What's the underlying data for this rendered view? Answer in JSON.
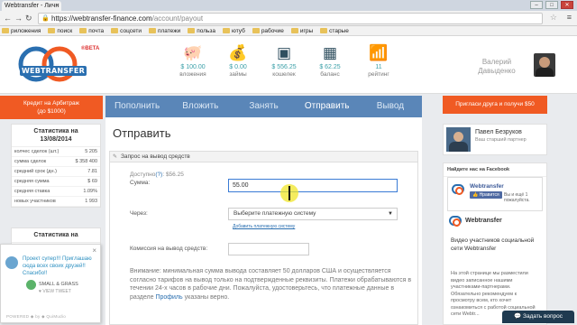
{
  "browser": {
    "tab_title": "Webtransfer - Личн",
    "tab_close": "×",
    "win_min": "–",
    "win_max": "□",
    "win_close": "✕",
    "url_host": "https://webtransfer-finance.com",
    "url_path": "/account/payout",
    "bookmarks": [
      "риложения",
      "поиск",
      "почта",
      "соцсети",
      "платежи",
      "польза",
      "ютуб",
      "рабочие",
      "игры",
      "старые"
    ]
  },
  "header": {
    "logo_text": "WEBTRANSFER",
    "beta": "®BETA",
    "stats": [
      {
        "value": "$ 100.00",
        "caption": "вложения",
        "icon": "piggy-bank-icon"
      },
      {
        "value": "$ 0.00",
        "caption": "займы",
        "icon": "money-bag-icon"
      },
      {
        "value": "$ 556.25",
        "caption": "кошелек",
        "icon": "safe-icon"
      },
      {
        "value": "$ 62.25",
        "caption": "баланс",
        "icon": "abacus-icon"
      },
      {
        "value": "11",
        "caption": "рейтинг",
        "icon": "chart-icon"
      }
    ],
    "user_first": "Валерий",
    "user_last": "Давыденко"
  },
  "left": {
    "arbitrage_btn_line1": "Кредит на Арбитраж",
    "arbitrage_btn_line2": "(до $1000)",
    "stats_title_line1": "Статистика на",
    "stats_title_line2": "13/08/2014",
    "stats_rows": [
      {
        "label": "колчес сделок (шт.)",
        "value": "5 205"
      },
      {
        "label": "сумма сделок",
        "value": "$ 358 400"
      },
      {
        "label": "средний срок (дн.)",
        "value": "7.81"
      },
      {
        "label": "средняя сумма",
        "value": "$ 69"
      },
      {
        "label": "средняя ставка",
        "value": "1.09%"
      },
      {
        "label": "новых участников",
        "value": "1 993"
      }
    ],
    "stats2_title": "Статистика на",
    "tweet": {
      "close": "×",
      "text": "Проект супер!!! Приглашаю сюда всех своих друзей!! Спасибо!!",
      "handle": "SMALL & GRASS",
      "action": "♥ VIEW TWEET",
      "powered": "POWERED ◆ by ◆ QuiMudio"
    }
  },
  "nav": {
    "items": [
      "Пополнить",
      "Вложить",
      "Занять",
      "Отправить",
      "Вывод"
    ]
  },
  "main": {
    "title": "Отправить",
    "panel_title": "Запрос на вывод средств",
    "available_label": "Доступно",
    "available_help": "(?)",
    "available_value": ": $56.25",
    "sum_label": "Сумма:",
    "sum_value": "55.00",
    "via_label": "Через:",
    "select_value": "Выберите платежную систему",
    "add_link": "Добавить платежную систему",
    "fee_label": "Комиссия на вывод средств:",
    "notice_1": "Внимание: минимальная сумма вывода составляет 50 долларов США и осуществляется согласно тарифов на вывод только на подтвержденные реквизиты. Платежи обрабатываются в течении 24-х часов в рабочие дни. Пожалуйста, удостоверьтесь, что платежные данные в разделе ",
    "notice_link": "Профиль",
    "notice_2": " указаны верно."
  },
  "right": {
    "invite_btn": "Пригласи друга и получи $50",
    "partner_name": "Павел Безруков",
    "partner_role": "Ваш старший партнер",
    "fb_head": "Найдите нас на Facebook",
    "fb_page": "Webtransfer",
    "fb_like": "👍 Нравится",
    "fb_likes": "Вы и ещё 1 пожалуйста.",
    "post_name": "Webtransfer",
    "post_text": "Видео участников социальной сети Webtransfer",
    "post_text2": "На этой странице мы разместили видео записанное нашими участниками-партнерами. Обязательно рекомендуем к просмотру всем, кто хочет ознакомиться с работой социальной сети Webtr..."
  },
  "ask_btn": "Задать вопрос",
  "colors": {
    "orange": "#f05a23",
    "nav_blue": "#5a86b8",
    "accent_teal": "#3ba0a8",
    "link_blue": "#2a6fb0"
  }
}
